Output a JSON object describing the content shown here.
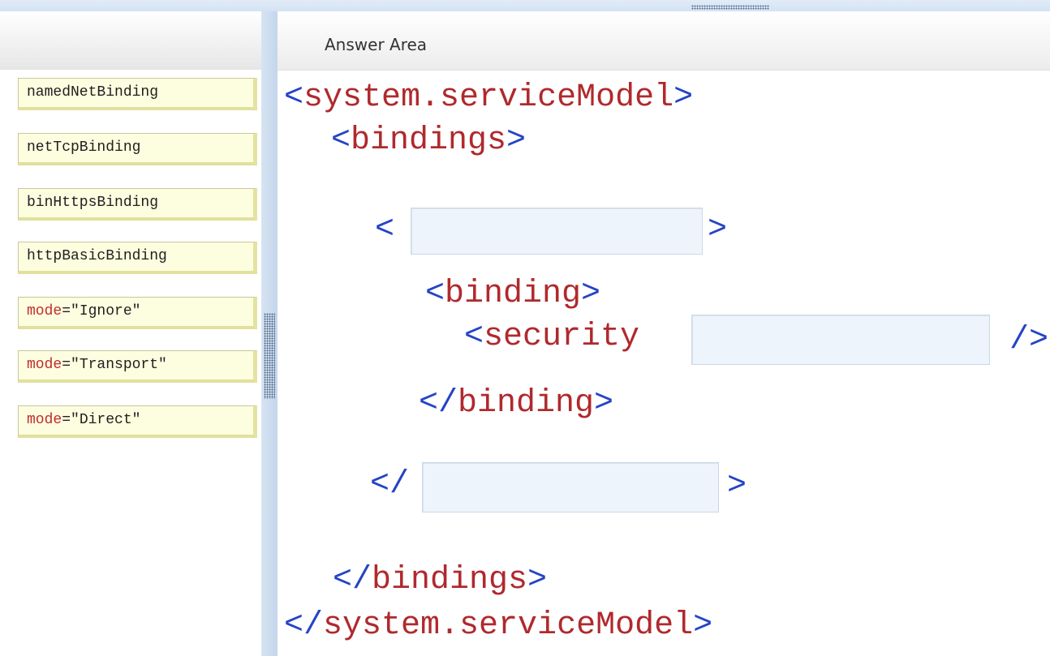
{
  "left_panel": {
    "options": [
      {
        "id": "namedNetBinding",
        "parts": [
          "namedNetBinding"
        ]
      },
      {
        "id": "netTcpBinding",
        "parts": [
          "netTcpBinding"
        ]
      },
      {
        "id": "binHttpsBinding",
        "parts": [
          "binHttpsBinding"
        ]
      },
      {
        "id": "httpBasicBinding",
        "parts": [
          "httpBasicBinding"
        ]
      },
      {
        "id": "mode-ignore",
        "parts": [
          "mode",
          "=\"Ignore\""
        ]
      },
      {
        "id": "mode-transport",
        "parts": [
          "mode",
          "=\"Transport\""
        ]
      },
      {
        "id": "mode-direct",
        "parts": [
          "mode",
          "=\"Direct\""
        ]
      }
    ]
  },
  "answer_area": {
    "title": "Answer Area",
    "code": {
      "l1": {
        "open": "<",
        "name": "system.serviceModel",
        "close": ">"
      },
      "l2": {
        "open": "<",
        "name": "bindings",
        "close": ">"
      },
      "l3": {
        "open": "<",
        "close": ">"
      },
      "l4": {
        "open": "<",
        "name": "binding",
        "close": ">"
      },
      "l5": {
        "open": "<",
        "name": "security",
        "close": "/>"
      },
      "l6": {
        "open": "</",
        "name": "binding",
        "close": ">"
      },
      "l7": {
        "open": "</",
        "close": ">"
      },
      "l8": {
        "open": "</",
        "name": "bindings",
        "close": ">"
      },
      "l9": {
        "open": "</",
        "name": "system.serviceModel",
        "close": ">"
      }
    }
  },
  "colors": {
    "tag_name": "#b0292d",
    "bracket": "#2544c4",
    "tile_background": "#fdfde0",
    "drop_target": "#eef4fb"
  }
}
